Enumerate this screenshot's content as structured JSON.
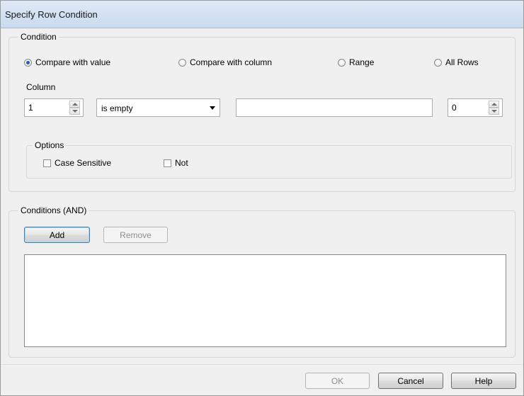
{
  "window": {
    "title": "Specify Row Condition"
  },
  "condition": {
    "label": "Condition",
    "modes": [
      {
        "label": "Compare with value",
        "selected": true
      },
      {
        "label": "Compare with column",
        "selected": false
      },
      {
        "label": "Range",
        "selected": false
      },
      {
        "label": "All Rows",
        "selected": false
      }
    ],
    "column_label": "Column",
    "column_value": "1",
    "operator_value": "is empty",
    "compare_value": "",
    "number_value": "0",
    "options": {
      "label": "Options",
      "case_sensitive": {
        "label": "Case Sensitive",
        "checked": false
      },
      "not": {
        "label": "Not",
        "checked": false
      }
    }
  },
  "conditions_and": {
    "label": "Conditions (AND)",
    "add_label": "Add",
    "remove_label": "Remove"
  },
  "footer": {
    "ok_label": "OK",
    "cancel_label": "Cancel",
    "help_label": "Help"
  },
  "colors": {
    "title_bar": "#c9daf0",
    "dialog_bg": "#f0f0f0",
    "radio_selected": "#1f5fb8",
    "default_button_border": "#3c7fb1"
  },
  "icons": {
    "spin_up": "up-arrow-icon",
    "spin_down": "down-arrow-icon",
    "dropdown": "chevron-down-icon"
  }
}
